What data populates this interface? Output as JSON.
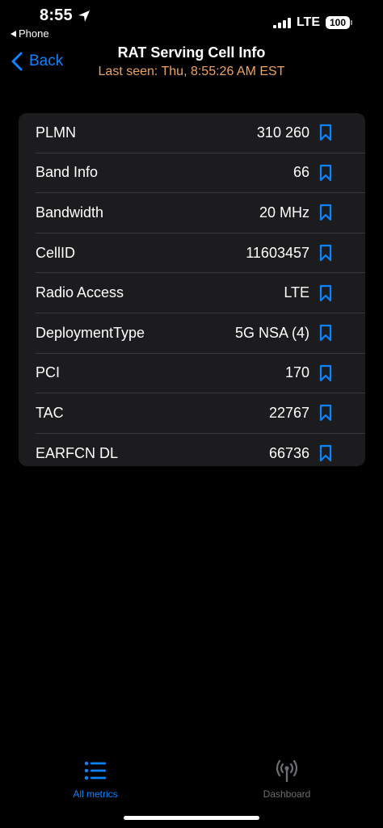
{
  "status_bar": {
    "time": "8:55",
    "back_app_label": "Phone",
    "network": "LTE",
    "battery": "100"
  },
  "nav": {
    "back_label": "Back",
    "title": "RAT Serving Cell Info",
    "subtitle": "Last seen: Thu, 8:55:26 AM EST"
  },
  "rows": [
    {
      "label": "PLMN",
      "value": "310 260"
    },
    {
      "label": "Band Info",
      "value": "66"
    },
    {
      "label": "Bandwidth",
      "value": "20 MHz"
    },
    {
      "label": "CellID",
      "value": "11603457"
    },
    {
      "label": "Radio Access",
      "value": "LTE"
    },
    {
      "label": "DeploymentType",
      "value": "5G NSA (4)"
    },
    {
      "label": "PCI",
      "value": "170"
    },
    {
      "label": "TAC",
      "value": "22767"
    },
    {
      "label": "EARFCN DL",
      "value": "66736"
    }
  ],
  "tabs": {
    "metrics_label": "All metrics",
    "dashboard_label": "Dashboard",
    "metrics_icon": "list-icon",
    "dashboard_icon": "antenna-icon"
  },
  "colors": {
    "accent": "#0a84ff",
    "subtitle": "#f0a35c",
    "background": "#000000",
    "card": "#1c1c1e"
  }
}
